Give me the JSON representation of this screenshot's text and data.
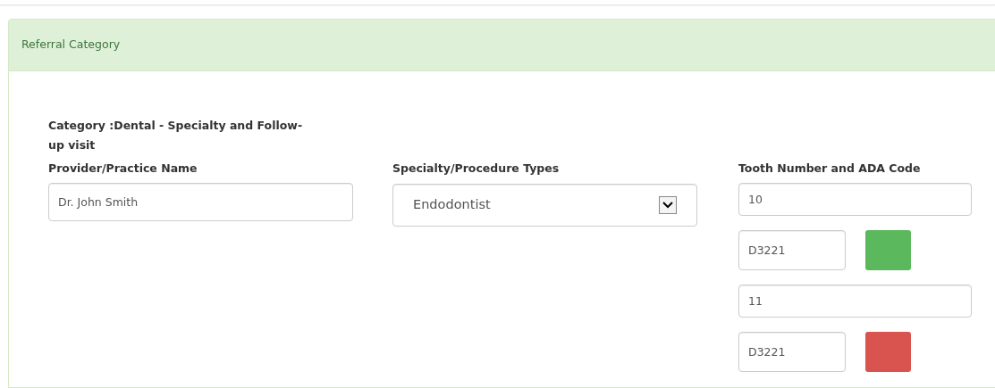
{
  "panel": {
    "title": "Referral Category",
    "category": "Category :Dental - Specialty and Follow-up visit",
    "provider": {
      "label": "Provider/Practice Name",
      "value": "Dr. John Smith"
    },
    "specialty": {
      "label": "Specialty/Procedure Types",
      "value": "Endodontist"
    },
    "teeth": {
      "label": "Tooth Number and ADA Code",
      "items": [
        {
          "tooth": "10",
          "code": "D3221",
          "color": "#5cb85c"
        },
        {
          "tooth": "11",
          "code": "D3221",
          "color": "#d9534f"
        }
      ]
    }
  }
}
